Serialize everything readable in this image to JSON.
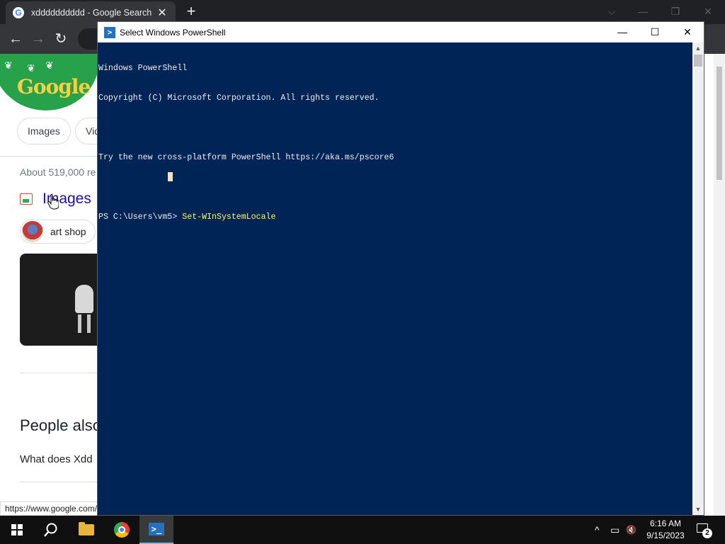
{
  "browser": {
    "tab_title": "xdddddddddd - Google Search",
    "tab_close": "✕",
    "new_tab": "+",
    "nav": {
      "back": "←",
      "forward": "→",
      "reload": "↻"
    },
    "window_controls": {
      "dropdown": "⌵",
      "minimize": "—",
      "restore": "❐",
      "close": "✕"
    },
    "page": {
      "doodle_text": "Google",
      "chips": [
        "Images",
        "Vid"
      ],
      "result_count": "About 519,000 re",
      "images_heading": "Images",
      "art_chip": "art shop",
      "paa_heading": "People also",
      "paa_question": "What does Xdd"
    },
    "status_url": "https://www.google.com/"
  },
  "powershell": {
    "title": "Select Windows PowerShell",
    "controls": {
      "minimize": "—",
      "maximize": "☐",
      "close": "✕"
    },
    "lines": [
      "Windows PowerShell",
      "Copyright (C) Microsoft Corporation. All rights reserved.",
      "",
      "Try the new cross-platform PowerShell https://aka.ms/pscore6",
      "",
      "PS C:\\Users\\vm5> "
    ],
    "command": "Set-WInSystemLocale",
    "scroll_up": "▲",
    "scroll_down": "▼",
    "colors": {
      "background": "#012456",
      "text": "#eeedf0",
      "command": "#ffff3b"
    }
  },
  "taskbar": {
    "search_icon": "⚲",
    "tray": {
      "chevron": "^",
      "network": "▭",
      "volume": "🔇"
    },
    "clock_time": "6:16 AM",
    "clock_date": "9/15/2023",
    "notification_count": "2"
  }
}
